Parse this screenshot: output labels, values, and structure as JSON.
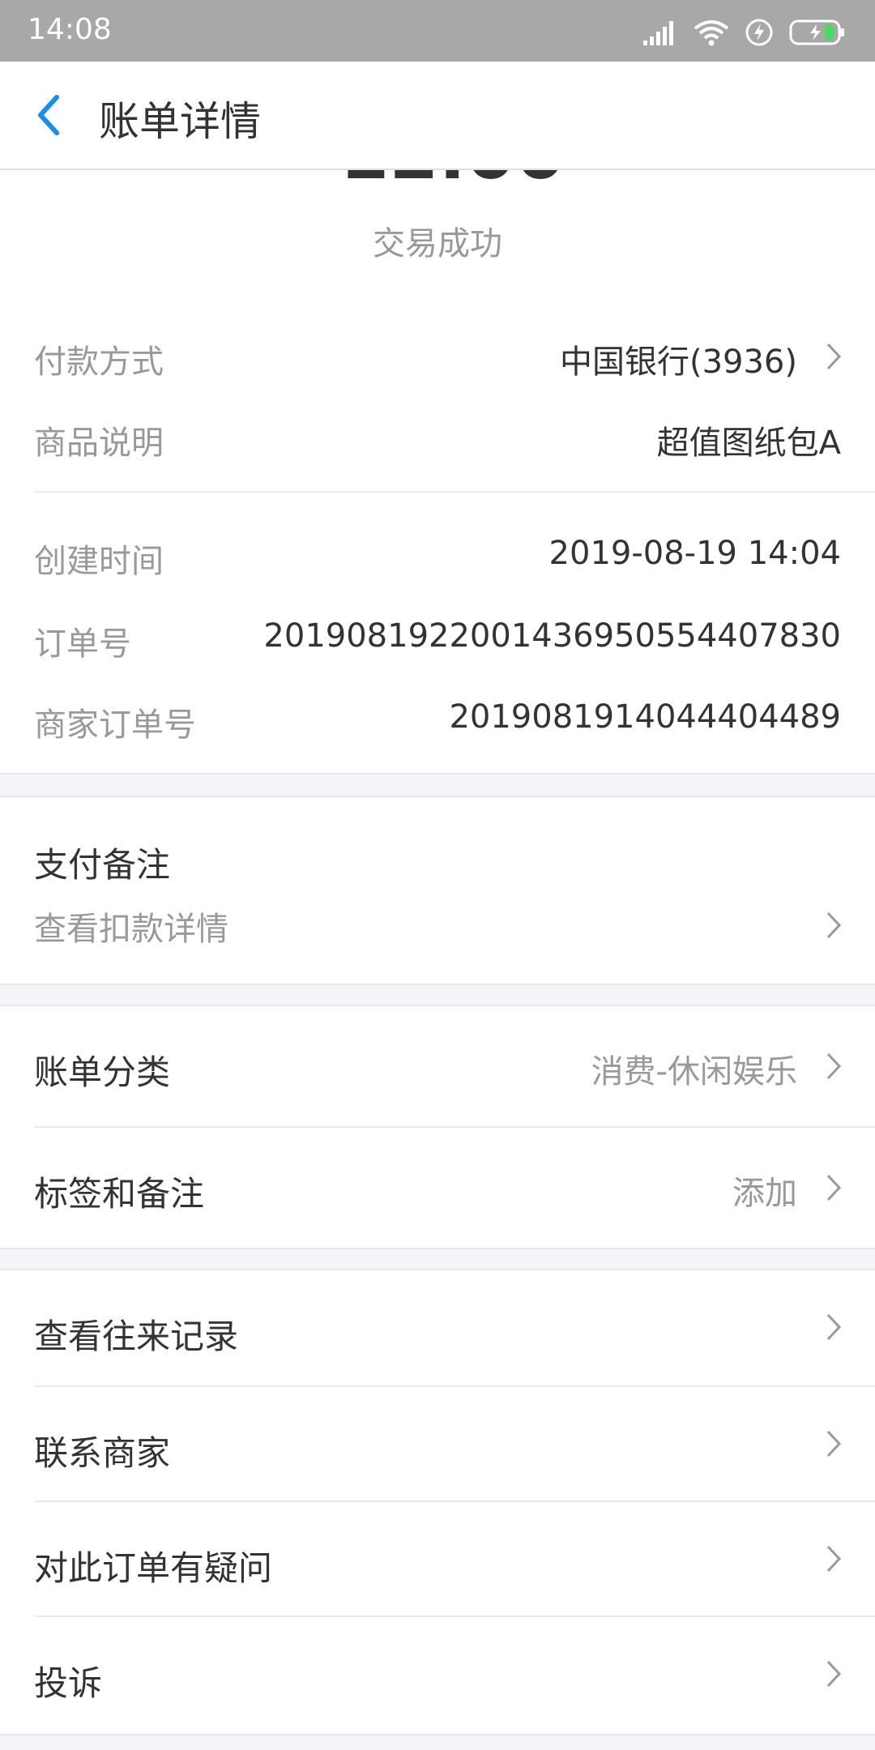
{
  "status_bar": {
    "time": "14:08",
    "icons": [
      "signal-icon",
      "wifi-icon",
      "charging-bolt-icon",
      "battery-icon"
    ]
  },
  "header": {
    "title": "账单详情",
    "back_icon": "chevron-left-icon"
  },
  "summary": {
    "status": "交易成功"
  },
  "details": {
    "payment_method_label": "付款方式",
    "payment_method_value": "中国银行(3936)",
    "product_desc_label": "商品说明",
    "product_desc_value": "超值图纸包A",
    "created_time_label": "创建时间",
    "created_time_value": "2019-08-19 14:04",
    "order_no_label": "订单号",
    "order_no_value": "2019081922001436950554407830",
    "merchant_order_no_label": "商家订单号",
    "merchant_order_no_value": "2019081914044404489"
  },
  "payment_note": {
    "title": "支付备注",
    "link_label": "查看扣款详情"
  },
  "classification": {
    "category_label": "账单分类",
    "category_value": "消费-休闲娱乐",
    "tags_label": "标签和备注",
    "tags_value": "添加"
  },
  "actions": [
    {
      "label": "查看往来记录"
    },
    {
      "label": "联系商家"
    },
    {
      "label": "对此订单有疑问"
    },
    {
      "label": "投诉"
    }
  ],
  "colors": {
    "accent": "#1a8fe6",
    "status_bar": "#a8a8a8",
    "background": "#f5f5f9",
    "secondary_text": "#999999",
    "primary_text": "#333333",
    "battery_green": "#4cd964"
  }
}
